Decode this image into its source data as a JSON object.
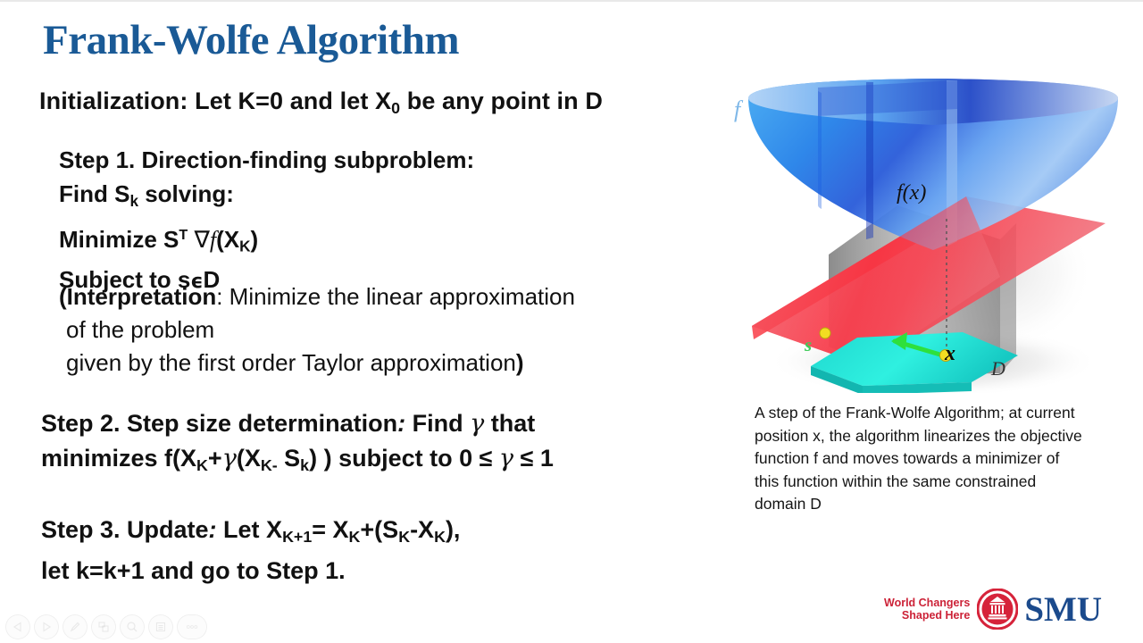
{
  "slide": {
    "title": "Frank-Wolfe Algorithm",
    "title_color": "#1a5a96",
    "background": "#ffffff"
  },
  "content": {
    "initialization": {
      "label": "Initialization:",
      "text_before": "Let   K=0 and let X",
      "subscript": "0",
      "text_after": "be any point in D"
    },
    "step1": {
      "heading": "Step 1. Direction-finding subproblem:",
      "line_find": "Find S",
      "line_find_sub": "k",
      "line_find_tail": " solving:",
      "line_minimize": "Minimize S",
      "line_minimize_sup": "T",
      "line_minimize_grad": "∇",
      "line_minimize_f": "f",
      "line_minimize_arg_open": "(X",
      "line_minimize_arg_sub": "K",
      "line_minimize_arg_close": ")",
      "line_subject": "Subject to s",
      "line_subject_eps": "ϵ",
      "line_subject_tail": "D"
    },
    "interpretation": {
      "lead": "(Interpretation",
      "line1_rest": ": Minimize the linear approximation",
      "line2": "of the problem",
      "line3": "given by the first order Taylor approximation",
      "closing": ")"
    },
    "step2": {
      "heading": "Step 2. Step size determination",
      "heading_colon": ":",
      "line1_tail": " Find  ",
      "gamma": "γ",
      "line1_end": " that",
      "line2_a": "minimizes f(X",
      "line2_sub1": "K",
      "line2_b": "+",
      "line2_c": "(X",
      "line2_sub2": "K-",
      "line2_d": " S",
      "line2_sub3": "k",
      "line2_e": ") )  subject to 0 ≤  ",
      "line2_f": " ≤  1"
    },
    "step3": {
      "heading": "Step 3. Update",
      "heading_colon": ":",
      "line1_a": " Let X",
      "line1_sub1": "K+1",
      "line1_b": "= X",
      "line1_sub2": "K",
      "line1_c": "+(S",
      "line1_sub3": "K",
      "line1_d": "-X",
      "line1_sub4": "K",
      "line1_e": "),",
      "line2": " let k=k+1 and go to Step 1."
    }
  },
  "figure": {
    "labels": {
      "f": "f",
      "fx": "f(x)",
      "x": "x",
      "s": "s",
      "domain": "D"
    },
    "colors": {
      "paraboloid_blue": "#2b9ff0",
      "paraboloid_dark_blue": "#1c46c8",
      "plane_red": "#f2616e",
      "plane_red_bright": "#f8212e",
      "prism_gray": "#8e8e8e",
      "base_cyan": "#27e0d8",
      "arrow_green": "#2ee03c",
      "point_yellow": "#f2dc22"
    }
  },
  "caption": {
    "text": "A step of the Frank-Wolfe Algorithm; at current position x, the algorithm linearizes the objective function f and moves towards a minimizer of this function within the same constrained domain D"
  },
  "logo": {
    "tagline_line1": "World Changers",
    "tagline_line2": "Shaped Here",
    "wordmark": "SMU",
    "tagline_color": "#cc2237",
    "seal_color": "#d6233a",
    "wordmark_color": "#1b4a8c"
  },
  "toolbar": {
    "items": [
      {
        "name": "previous-slide-button",
        "icon": "triangle-left-icon",
        "label": ""
      },
      {
        "name": "next-slide-button",
        "icon": "triangle-right-icon",
        "label": ""
      },
      {
        "name": "pen-tool-button",
        "icon": "pen-icon",
        "label": ""
      },
      {
        "name": "slide-overview-button",
        "icon": "grid-slides-icon",
        "label": ""
      },
      {
        "name": "zoom-button",
        "icon": "magnifier-icon",
        "label": ""
      },
      {
        "name": "menu-button",
        "icon": "list-menu-icon",
        "label": ""
      },
      {
        "name": "more-options-button",
        "icon": "ellipsis-icon",
        "label": "ooo"
      }
    ]
  }
}
